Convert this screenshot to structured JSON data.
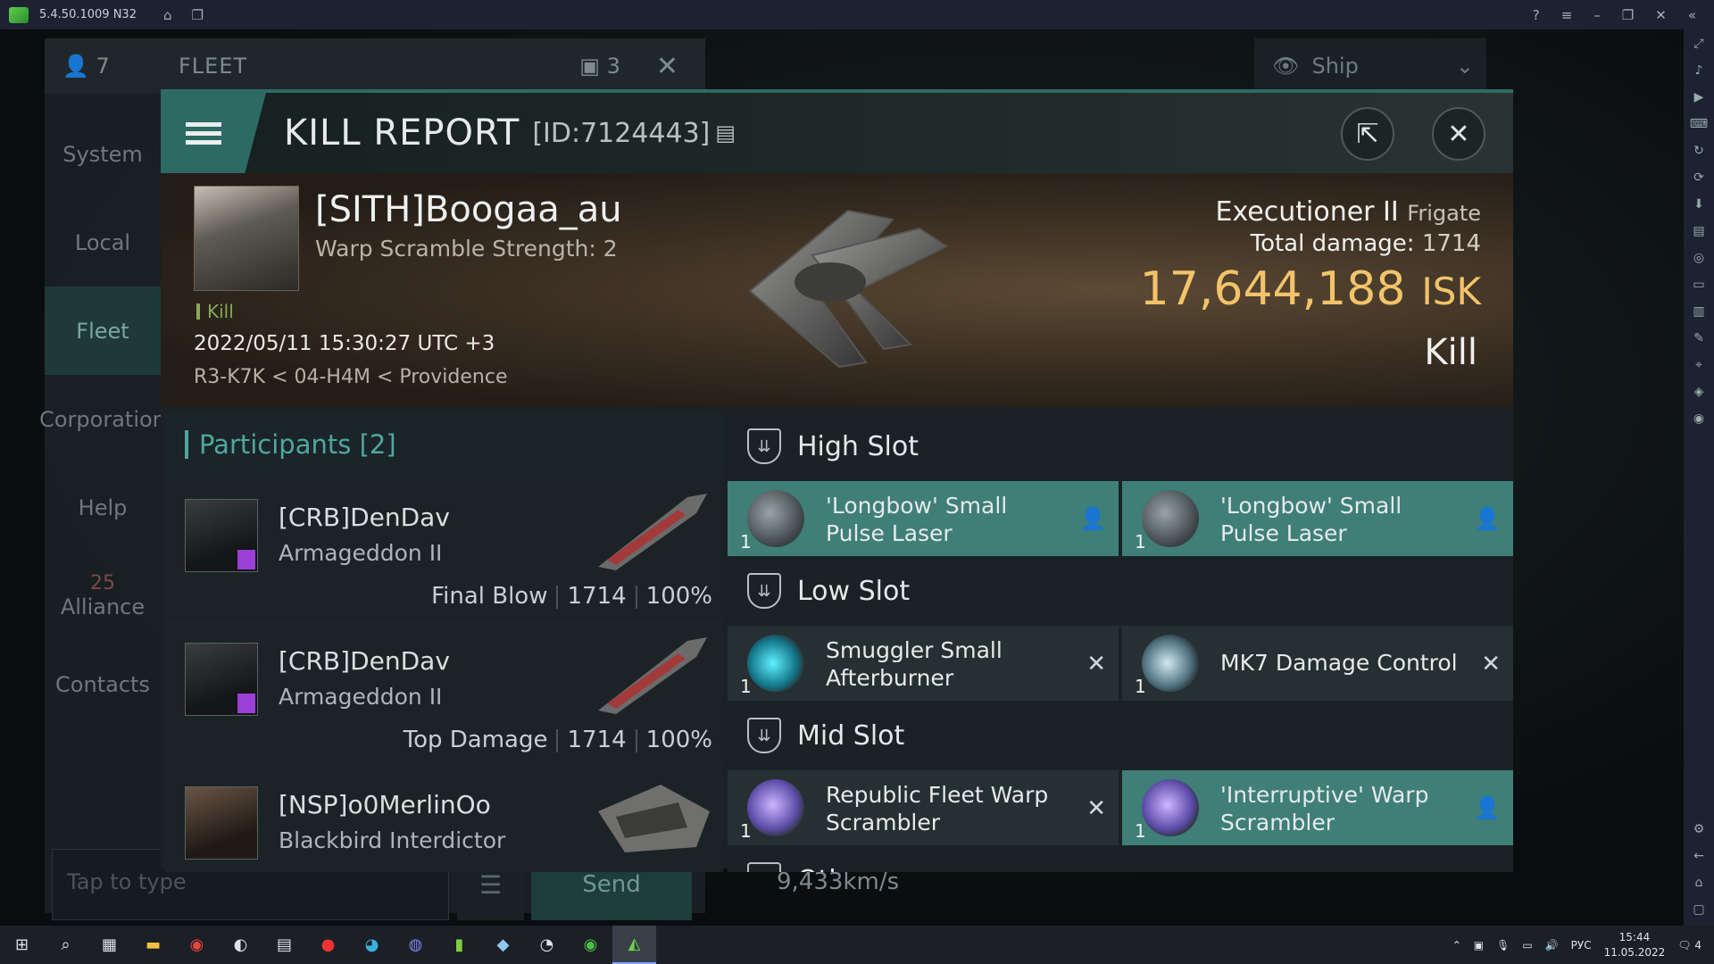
{
  "emulator": {
    "version": "5.4.50.1009 N32"
  },
  "fleet_panel": {
    "member_count": "7",
    "title": "FLEET",
    "window_count": "3",
    "nav": [
      "System",
      "Local",
      "Fleet",
      "Corporation",
      "Help",
      "Alliance",
      "Contacts"
    ],
    "alliance_badge": "25",
    "chat_placeholder": "Tap to type",
    "send_label": "Send",
    "ship_filter": "Ship",
    "speed": "9,433km/s"
  },
  "kill_report": {
    "title": "KILL REPORT",
    "id_label": "[ID:7124443]",
    "victim": {
      "name": "[SITH]Boogaa_au",
      "warp_scramble": "Warp Scramble Strength: 2",
      "kill_tag": "Kill",
      "timestamp": "2022/05/11 15:30:27 UTC +3",
      "location": "R3-K7K < 04-H4M < Providence",
      "ship_name": "Executioner II",
      "ship_class": "Frigate",
      "total_damage_label": "Total damage:",
      "total_damage": "1714",
      "isk_value": "17,644,188",
      "isk_unit": "ISK",
      "result": "Kill"
    },
    "participants": {
      "header": "Participants [2]",
      "rows": [
        {
          "name": "[CRB]DenDav",
          "ship": "Armageddon II",
          "label": "Final Blow",
          "damage": "1714",
          "percent": "100%"
        },
        {
          "name": "[CRB]DenDav",
          "ship": "Armageddon II",
          "label": "Top Damage",
          "damage": "1714",
          "percent": "100%"
        },
        {
          "name": "[NSP]o0MerlinOo",
          "ship": "Blackbird Interdictor"
        }
      ]
    },
    "slots": {
      "high": {
        "title": "High Slot",
        "items": [
          {
            "qty": "1",
            "name": "'Longbow' Small Pulse Laser"
          },
          {
            "qty": "1",
            "name": "'Longbow' Small Pulse Laser"
          }
        ]
      },
      "low": {
        "title": "Low Slot",
        "items": [
          {
            "qty": "1",
            "name": "Smuggler Small Afterburner"
          },
          {
            "qty": "1",
            "name": "MK7 Damage Control"
          }
        ]
      },
      "mid": {
        "title": "Mid Slot",
        "items": [
          {
            "qty": "1",
            "name": "Republic Fleet Warp Scrambler"
          },
          {
            "qty": "1",
            "name": "'Interruptive' Warp Scrambler"
          }
        ]
      },
      "others": {
        "title": "Others"
      }
    }
  },
  "taskbar": {
    "lang": "РУС",
    "time": "15:44",
    "date": "11.05.2022",
    "notif_count": "4"
  }
}
